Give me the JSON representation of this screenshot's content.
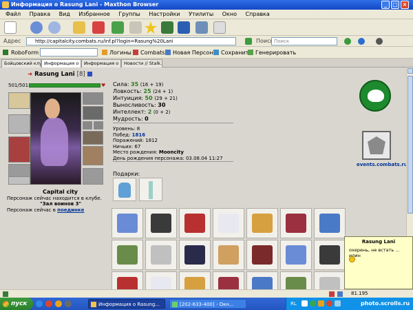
{
  "window": {
    "title": "Информация о Rasung Lani - Maxthon Browser"
  },
  "menu": [
    "Файл",
    "Правка",
    "Вид",
    "Избранное",
    "Группы",
    "Настройки",
    "Утилиты",
    "Окно",
    "Справка"
  ],
  "address": {
    "label": "Адрес",
    "url": "http://capitalcity.combats.ru/inf.pl?login=Rasung%20Lani",
    "search_label": "Поиск",
    "search_placeholder": "Поиск"
  },
  "linkbar": {
    "roboform": "RoboForm",
    "logins": "Логины",
    "combats": "Combats",
    "new_persona": "Новая Персона",
    "save": "Сохранить",
    "generate": "Генерировать"
  },
  "tabs": [
    "Бойцовский клуб",
    "Информация о R...",
    "Информация о R...",
    "Новости // Stalk..."
  ],
  "profile": {
    "name": "Rasung Lani",
    "level": "[8]",
    "hp": "501/501",
    "city": "Capital city",
    "location_text": "Персонаж сейчас находится в клубе.",
    "location_room": "\"Зал воинов 3\"",
    "fight_text": "Персонаж сейчас в",
    "fight_link": "поединке"
  },
  "stats": [
    {
      "label": "Сила:",
      "value": "35",
      "extra": "(16 + 19)"
    },
    {
      "label": "Ловкость:",
      "value": "25",
      "extra": "(24 + 1)"
    },
    {
      "label": "Интуиция:",
      "value": "50",
      "extra": "(29 + 21)"
    },
    {
      "label": "Выносливость:",
      "value": "30",
      "extra": ""
    },
    {
      "label": "Интеллект:",
      "value": "2",
      "extra": "(0 + 2)"
    },
    {
      "label": "Мудрость:",
      "value": "0",
      "extra": ""
    }
  ],
  "info": [
    {
      "label": "Уровень:",
      "value": "8"
    },
    {
      "label": "Побед:",
      "value": "1816"
    },
    {
      "label": "Поражений:",
      "value": "1812"
    },
    {
      "label": "Ничьих:",
      "value": "67"
    },
    {
      "label": "Место рождения:",
      "value": "Mooncity"
    },
    {
      "label": "День рождения персонажа:",
      "value": "03.08.04 11:27"
    }
  ],
  "gifts_label": "Подарки:",
  "logo_text": "events.combats.ru",
  "chat": {
    "name": "Rasung Lani",
    "message": "охерень, не встать ... илин"
  },
  "status": {
    "zoom": "81.195"
  },
  "taskbar": {
    "start": "пуск",
    "task1": "Информация о Rasung...",
    "task2": "[202-633-400] - Окн...",
    "lang": "RL",
    "watermark": "photo.scrolls.ru"
  },
  "colors": {
    "green": "#2c7a1e",
    "title_blue": "#1e5bd6",
    "link_blue": "#003399",
    "chat_bg": "#ffffc8"
  }
}
